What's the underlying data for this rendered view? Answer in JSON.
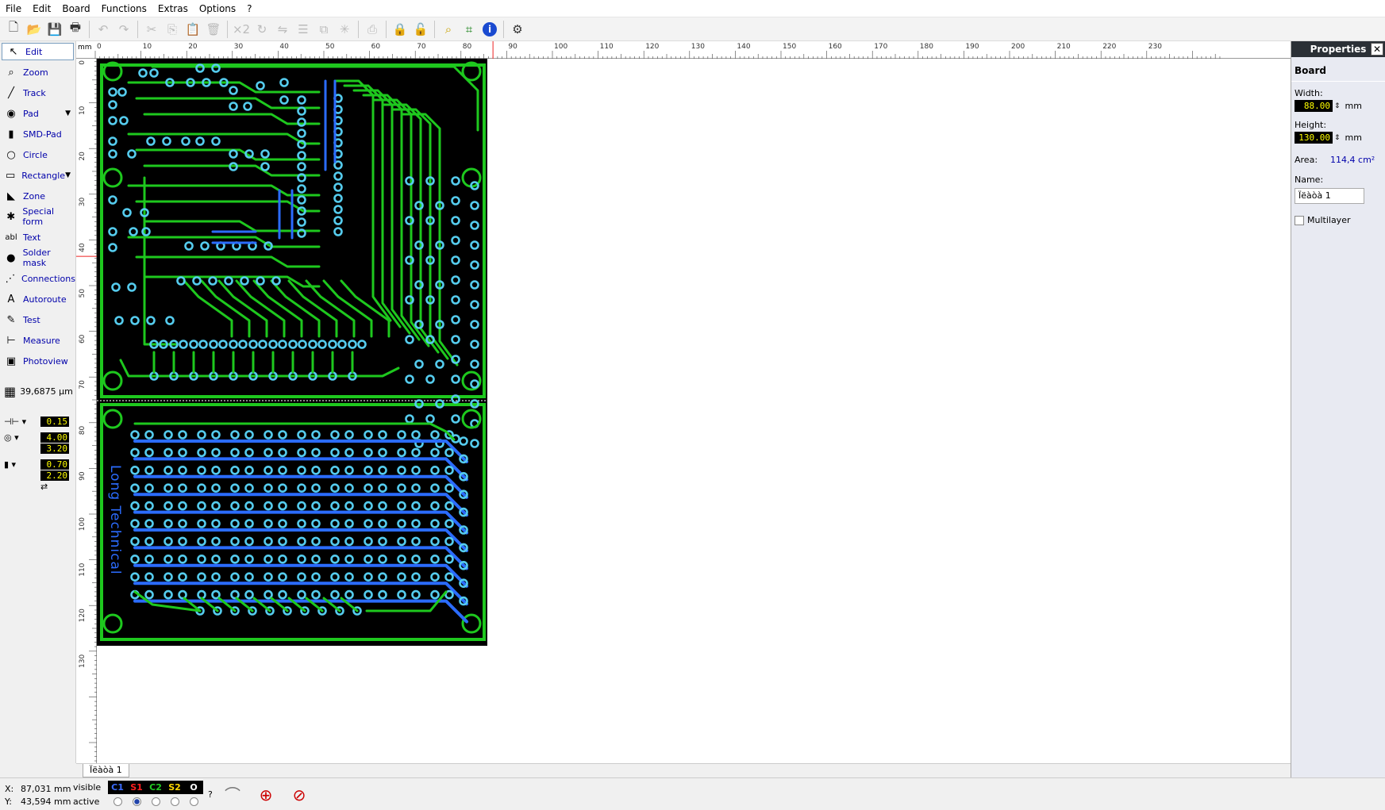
{
  "menu": [
    "File",
    "Edit",
    "Board",
    "Functions",
    "Extras",
    "Options",
    "?"
  ],
  "tools": [
    {
      "label": "Edit",
      "icon": "cursor-icon",
      "glyph": "↖",
      "selected": true
    },
    {
      "label": "Zoom",
      "icon": "zoom-icon",
      "glyph": "⌕"
    },
    {
      "label": "Track",
      "icon": "track-icon",
      "glyph": "╱"
    },
    {
      "label": "Pad",
      "icon": "pad-icon",
      "glyph": "◉",
      "dropdown": true
    },
    {
      "label": "SMD-Pad",
      "icon": "smd-pad-icon",
      "glyph": "▮"
    },
    {
      "label": "Circle",
      "icon": "circle-icon",
      "glyph": "○"
    },
    {
      "label": "Rectangle",
      "icon": "rectangle-icon",
      "glyph": "▭",
      "dropdown": true
    },
    {
      "label": "Zone",
      "icon": "zone-icon",
      "glyph": "◣"
    },
    {
      "label": "Special form",
      "icon": "special-form-icon",
      "glyph": "✱"
    },
    {
      "label": "Text",
      "icon": "text-icon",
      "glyph": "abl"
    },
    {
      "label": "Solder mask",
      "icon": "solder-mask-icon",
      "glyph": "●"
    },
    {
      "label": "Connections",
      "icon": "connections-icon",
      "glyph": "⋰"
    },
    {
      "label": "Autoroute",
      "icon": "autoroute-icon",
      "glyph": "A"
    },
    {
      "label": "Test",
      "icon": "test-icon",
      "glyph": "✎"
    },
    {
      "label": "Measure",
      "icon": "measure-icon",
      "glyph": "⊢"
    },
    {
      "label": "Photoview",
      "icon": "photoview-icon",
      "glyph": "▣"
    }
  ],
  "grid_value": "39,6875 µm",
  "track_width": "0.15",
  "pad_outer": "4.00",
  "pad_inner": "3.20",
  "smd_w": "0.70",
  "smd_h": "2.20",
  "ruler": {
    "unit": "mm",
    "top_labels": [
      "0",
      "10",
      "20",
      "30",
      "40",
      "50",
      "60",
      "70",
      "80",
      "90",
      "100",
      "110",
      "120",
      "130",
      "140",
      "150",
      "160",
      "170",
      "180",
      "190",
      "200",
      "210",
      "220",
      "230"
    ],
    "left_labels": [
      "0",
      "10",
      "20",
      "30",
      "40",
      "50",
      "60",
      "70",
      "80",
      "90",
      "100",
      "110",
      "120",
      "130"
    ]
  },
  "board_text": "Long Technical",
  "properties": {
    "title": "Properties",
    "close": "✕",
    "section": "Board",
    "width_label": "Width:",
    "width_value": "88.00",
    "height_label": "Height:",
    "height_value": "130.00",
    "unit": "mm",
    "area_label": "Area:",
    "area_value": "114,4 cm²",
    "name_label": "Name:",
    "name_value": "Ïëàòà 1",
    "multilayer_label": "Multilayer"
  },
  "tab_name": "Ïëàòà 1",
  "status": {
    "x_label": "X:",
    "x_value": "87,031 mm",
    "y_label": "Y:",
    "y_value": "43,594 mm",
    "visible_label": "visible",
    "active_label": "active",
    "help": "?"
  },
  "layers": [
    {
      "name": "C1",
      "color": "#3b6cff"
    },
    {
      "name": "S1",
      "color": "#ff2020"
    },
    {
      "name": "C2",
      "color": "#22cc22"
    },
    {
      "name": "S2",
      "color": "#ffd700"
    },
    {
      "name": "O",
      "color": "#ffffff"
    }
  ],
  "colors": {
    "copper_top": "#1ec81e",
    "copper_bottom": "#2b6cff",
    "pad": "#55ccee",
    "board_bg": "#000000"
  }
}
